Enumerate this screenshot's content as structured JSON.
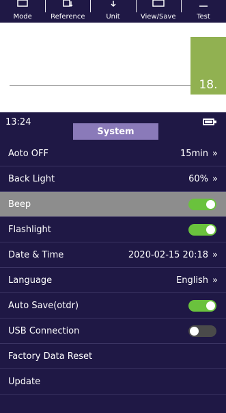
{
  "toolbar": {
    "items": [
      {
        "label": "Mode",
        "icon": "mode-icon"
      },
      {
        "label": "Reference",
        "icon": "reference-icon"
      },
      {
        "label": "Unit",
        "icon": "unit-icon"
      },
      {
        "label": "View/Save",
        "icon": "view-save-icon"
      },
      {
        "label": "Test",
        "icon": "test-icon"
      }
    ]
  },
  "page": {
    "number": "18."
  },
  "status_bar": {
    "time": "13:24",
    "battery_icon": "battery-full-icon"
  },
  "header": {
    "tab_label": "System"
  },
  "settings": [
    {
      "label": "Aoto OFF",
      "value": "15min",
      "type": "value"
    },
    {
      "label": "Back Light",
      "value": "60%",
      "type": "value"
    },
    {
      "label": "Beep",
      "type": "toggle",
      "state": "on",
      "highlighted": true
    },
    {
      "label": "Flashlight",
      "type": "toggle",
      "state": "on"
    },
    {
      "label": "Date & Time",
      "value": "2020-02-15  20:18",
      "type": "value"
    },
    {
      "label": "Language",
      "value": "English",
      "type": "value"
    },
    {
      "label": "Auto Save(otdr)",
      "type": "toggle",
      "state": "on"
    },
    {
      "label": "USB Connection",
      "type": "toggle",
      "state": "off"
    },
    {
      "label": "Factory Data Reset",
      "type": "action"
    },
    {
      "label": "Update",
      "type": "action"
    }
  ],
  "colors": {
    "screen_background": "#1f1845",
    "tab_background": "#8a7ab9",
    "highlight_row": "#8d8d8d",
    "toggle_on": "#6ac23d",
    "toggle_off": "#4a4a4a",
    "page_number_box": "#91b151"
  }
}
